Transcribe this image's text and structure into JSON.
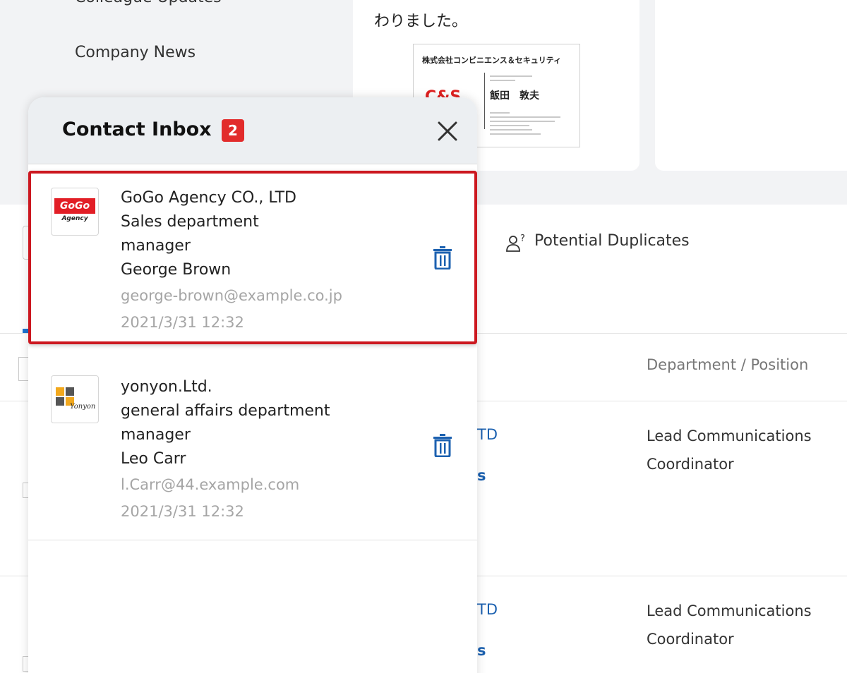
{
  "background": {
    "nav": {
      "partial_item": "Colleague Updates",
      "news": "Company News"
    },
    "note_text": "わりました。",
    "business_card": {
      "company": "株式会社コンビニエンス＆セキュリティ",
      "logo_text": "C&S",
      "name": "飯田　敦夫"
    },
    "potential_duplicates": "Potential Duplicates",
    "table": {
      "column_department": "Department / Position",
      "rows": [
        {
          "company_peek": "TD",
          "name_peek": "s",
          "role_line1": "Lead Communications",
          "role_line2": "Coordinator"
        },
        {
          "company_peek": "TD",
          "name_peek": "s",
          "role_line1": "Lead Communications",
          "role_line2": "Coordinator"
        }
      ]
    }
  },
  "modal": {
    "title": "Contact Inbox",
    "badge": "2",
    "items": [
      {
        "logo": {
          "top": "GoGo",
          "bottom": "Agency"
        },
        "company": "GoGo Agency CO., LTD",
        "department": "Sales department",
        "position": "manager",
        "name": "George Brown",
        "email": "george-brown@example.co.jp",
        "date": "2021/3/31 12:32"
      },
      {
        "logo": {
          "word": "Yonyon"
        },
        "company": "yonyon.Ltd.",
        "department": "general affairs department",
        "position": "manager",
        "name": "Leo Carr",
        "email": "l.Carr@44.example.com",
        "date": "2021/3/31 12:32"
      }
    ]
  },
  "colors": {
    "selected_outline": "#cc1820",
    "badge": "#e22b2b",
    "trash_icon": "#1c61b0",
    "link_blue": "#1c61b0"
  }
}
